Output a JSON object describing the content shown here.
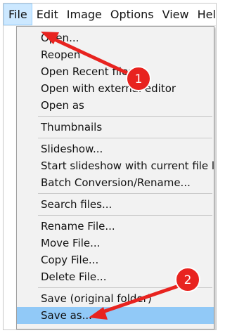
{
  "menubar": {
    "items": [
      {
        "label": "File"
      },
      {
        "label": "Edit"
      },
      {
        "label": "Image"
      },
      {
        "label": "Options"
      },
      {
        "label": "View"
      },
      {
        "label": "Help"
      }
    ]
  },
  "file_menu": {
    "groups": [
      [
        "Open...",
        "Reopen",
        "Open Recent files",
        "Open with external editor",
        "Open as"
      ],
      [
        "Thumbnails"
      ],
      [
        "Slideshow...",
        "Start slideshow with current file list",
        "Batch Conversion/Rename..."
      ],
      [
        "Search files..."
      ],
      [
        "Rename File...",
        "Move File...",
        "Copy File...",
        "Delete File..."
      ],
      [
        "Save (original folder)",
        "Save as..."
      ]
    ],
    "highlighted_item": "Save as..."
  },
  "annotations": {
    "badge_1": "1",
    "badge_2": "2",
    "arrow_color": "#e8231f"
  }
}
